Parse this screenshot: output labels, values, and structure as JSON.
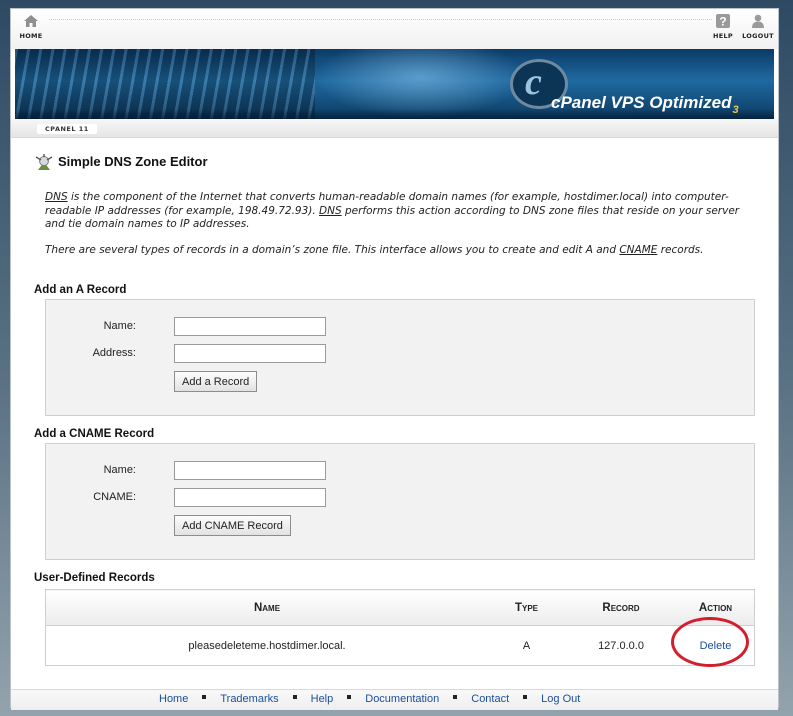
{
  "topnav": {
    "home_label": "HOME",
    "help_label": "HELP",
    "logout_label": "LOGOUT"
  },
  "banner": {
    "logo_letter": "c",
    "brand": "cPanel",
    "product": "VPS Optimized",
    "version": "3"
  },
  "breadcrumb": "CPANEL 11",
  "page": {
    "title": "Simple DNS Zone Editor",
    "desc1_a": "DNS",
    "desc1_b": " is the component of the Internet that converts human-readable domain names (for example, hostdimer.local) into computer-readable IP addresses (for example, 198.49.72.93). ",
    "desc1_c": "DNS",
    "desc1_d": " performs this action according to DNS zone files that reside on your server and tie domain names to IP addresses.",
    "desc2_a": "There are several types of records in a domain’s zone file. This interface allows you to create and edit A and ",
    "desc2_b": "CNAME",
    "desc2_c": " records."
  },
  "a_record": {
    "title": "Add an A Record",
    "name_label": "Name:",
    "name_value": "",
    "address_label": "Address:",
    "address_value": "",
    "button": "Add a Record"
  },
  "cname_record": {
    "title": "Add a CNAME Record",
    "name_label": "Name:",
    "name_value": "",
    "cname_label": "CNAME:",
    "cname_value": "",
    "button": "Add CNAME Record"
  },
  "records": {
    "title": "User-Defined Records",
    "headers": {
      "name": "Name",
      "type": "Type",
      "record": "Record",
      "action": "Action"
    },
    "rows": [
      {
        "name": "pleasedeleteme.hostdimer.local.",
        "type": "A",
        "record": "127.0.0.0",
        "action": "Delete"
      }
    ]
  },
  "footer": {
    "links": [
      "Home",
      "Trademarks",
      "Help",
      "Documentation",
      "Contact",
      "Log Out"
    ]
  },
  "colors": {
    "link": "#1b4f9c",
    "highlight_oval": "#d31e2e",
    "panel_bg": "#f2f2f2"
  }
}
